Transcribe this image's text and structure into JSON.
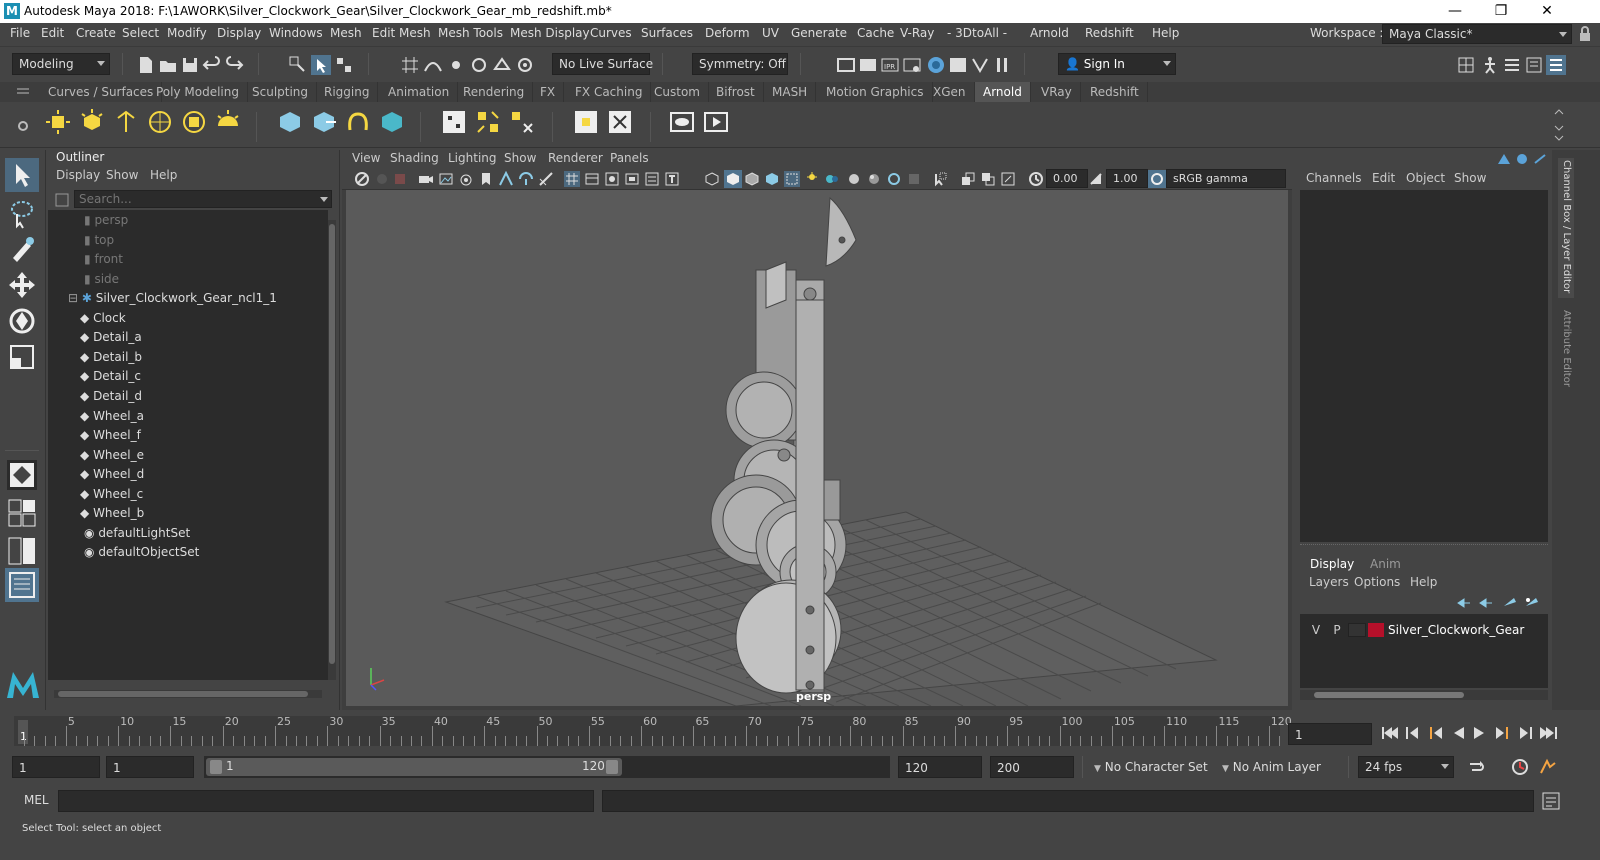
{
  "window": {
    "title": "Autodesk Maya 2018: F:\\1AWORK\\Silver_Clockwork_Gear\\Silver_Clockwork_Gear_mb_redshift.mb*",
    "logo": "M",
    "minimize": "—",
    "maximize": "❐",
    "close": "✕"
  },
  "menubar": {
    "items": [
      "File",
      "Edit",
      "Create",
      "Select",
      "Modify",
      "Display",
      "Windows",
      "Mesh",
      "Edit Mesh",
      "Mesh Tools",
      "Mesh Display",
      "Curves",
      "Surfaces",
      "Deform",
      "UV",
      "Generate",
      "Cache",
      "V-Ray",
      "- 3DtoAll -",
      "Arnold",
      "Redshift",
      "Help"
    ],
    "workspace_label": "Workspace :",
    "workspace_value": "Maya Classic*"
  },
  "statusline": {
    "mode": "Modeling",
    "live_surface": "No Live Surface",
    "symmetry": "Symmetry: Off",
    "sign_in": "Sign In"
  },
  "shelf": {
    "tabs": [
      "Curves / Surfaces",
      "Poly Modeling",
      "Sculpting",
      "Rigging",
      "Animation",
      "Rendering",
      "FX",
      "FX Caching",
      "Custom",
      "Bifrost",
      "MASH",
      "Motion Graphics",
      "XGen",
      "Arnold",
      "VRay",
      "Redshift"
    ],
    "active_tab": "Arnold"
  },
  "outliner": {
    "title": "Outliner",
    "menu": [
      "Display",
      "Show",
      "Help"
    ],
    "search_placeholder": "Search...",
    "cameras": [
      "persp",
      "top",
      "front",
      "side"
    ],
    "group": "Silver_Clockwork_Gear_ncl1_1",
    "children": [
      "Clock",
      "Detail_a",
      "Detail_b",
      "Detail_c",
      "Detail_d",
      "Wheel_a",
      "Wheel_f",
      "Wheel_e",
      "Wheel_d",
      "Wheel_c",
      "Wheel_b"
    ],
    "sets": [
      "defaultLightSet",
      "defaultObjectSet"
    ]
  },
  "viewport": {
    "menu": [
      "View",
      "Shading",
      "Lighting",
      "Show",
      "Renderer",
      "Panels"
    ],
    "exposure": "0.00",
    "gamma": "1.00",
    "color_space": "sRGB gamma",
    "camera_label": "persp"
  },
  "channelbox": {
    "menu": [
      "Channels",
      "Edit",
      "Object",
      "Show"
    ],
    "side_tab_1": "Channel Box / Layer Editor",
    "side_tab_2": "Attribute Editor"
  },
  "layers": {
    "tabs": [
      "Display",
      "Anim"
    ],
    "active_tab": "Display",
    "menu": [
      "Layers",
      "Options",
      "Help"
    ],
    "layer": {
      "v": "V",
      "p": "P",
      "name": "Silver_Clockwork_Gear",
      "color": "#b5102a"
    }
  },
  "timeline": {
    "ticks": [
      "5",
      "10",
      "15",
      "20",
      "25",
      "30",
      "35",
      "40",
      "45",
      "50",
      "55",
      "60",
      "65",
      "70",
      "75",
      "80",
      "85",
      "90",
      "95",
      "100",
      "105",
      "110",
      "115",
      "120"
    ],
    "start_marker": "1",
    "current_frame": "1"
  },
  "range": {
    "start": "1",
    "playback_start": "1",
    "slider_start": "1",
    "slider_end": "120",
    "playback_end": "120",
    "end": "200",
    "character_set": "No Character Set",
    "anim_layer": "No Anim Layer",
    "fps": "24 fps"
  },
  "command": {
    "label": "MEL"
  },
  "help": {
    "text": "Select Tool: select an object"
  },
  "colors": {
    "accent": "#5ba3d9",
    "panel": "#444444",
    "field": "#2b2b2b",
    "scene": "#5a5a5a"
  }
}
